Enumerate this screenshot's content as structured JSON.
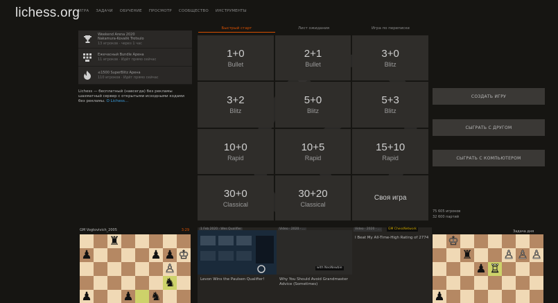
{
  "header": {
    "logo": "lichess.org",
    "nav": [
      "ИГРА",
      "ЗАДАЧИ",
      "ОБУЧЕНИЕ",
      "ПРОСМОТР",
      "СООБЩЕСТВО",
      "ИНСТРУМЕНТЫ"
    ]
  },
  "lobby_tabs": [
    "Быстрый старт",
    "Лист ожидания",
    "Игра по переписке"
  ],
  "tournaments": [
    {
      "icon": "trophy-icon",
      "name": "Weekend Arena 2020",
      "line2": "Nakamura-Kovalik Trotsulo",
      "line3": "13 игроков · через 1 час"
    },
    {
      "icon": "grid-icon",
      "name": "Ежечасный Bundle Арена",
      "line2": "11 игроков · Идёт прямо сейчас",
      "line3": ""
    },
    {
      "icon": "flame-icon",
      "name": "≤1500 SuperBlitz Арена",
      "line2": "110 игроков · Идёт прямо сейчас",
      "line3": ""
    }
  ],
  "intro": {
    "text": "Lichess — бесплатный (навсегда) без рекламы шахматный сервер с открытыми исходными кодами без рекламы.",
    "link": "О Lichess..."
  },
  "pools": [
    {
      "time": "1+0",
      "type": "Bullet"
    },
    {
      "time": "2+1",
      "type": "Bullet"
    },
    {
      "time": "3+0",
      "type": "Blitz"
    },
    {
      "time": "3+2",
      "type": "Blitz"
    },
    {
      "time": "5+0",
      "type": "Blitz"
    },
    {
      "time": "5+3",
      "type": "Blitz"
    },
    {
      "time": "10+0",
      "type": "Rapid"
    },
    {
      "time": "10+5",
      "type": "Rapid"
    },
    {
      "time": "15+10",
      "type": "Rapid"
    },
    {
      "time": "30+0",
      "type": "Classical"
    },
    {
      "time": "30+20",
      "type": "Classical"
    },
    {
      "time": "Своя игра",
      "type": ""
    }
  ],
  "actions": {
    "create": "СОЗДАТЬ ИГРУ",
    "friend": "СЫГРАТЬ С ДРУГОМ",
    "computer": "СЫГРАТЬ С КОМПЬЮТЕРОМ"
  },
  "stats": {
    "players": "75 605 игроков",
    "games": "32 600 партий"
  },
  "bottom": {
    "left_board_player": "GM Vogtovivich_2005",
    "left_board_rating": "3:29",
    "right_board_label": "Задача дня",
    "videos": [
      {
        "tag": "1 Feb 2020 · Wes Qualifier",
        "title": "Levon Wins the Paulsen Qualifier!",
        "author": ""
      },
      {
        "tag": "Video · 2020 · ...",
        "title": "Why You Should Avoid Grandmaster Advice (Sometimes)",
        "author": "with NeoNewbie"
      },
      {
        "tag": "Video · 2020 · ...",
        "title": "I Beat My All-Time-High Rating of 2774",
        "author": "GM ChessNetwork"
      }
    ]
  },
  "colors": {
    "accent": "#d85000",
    "link": "#3b9ede",
    "bg": "#161512"
  }
}
